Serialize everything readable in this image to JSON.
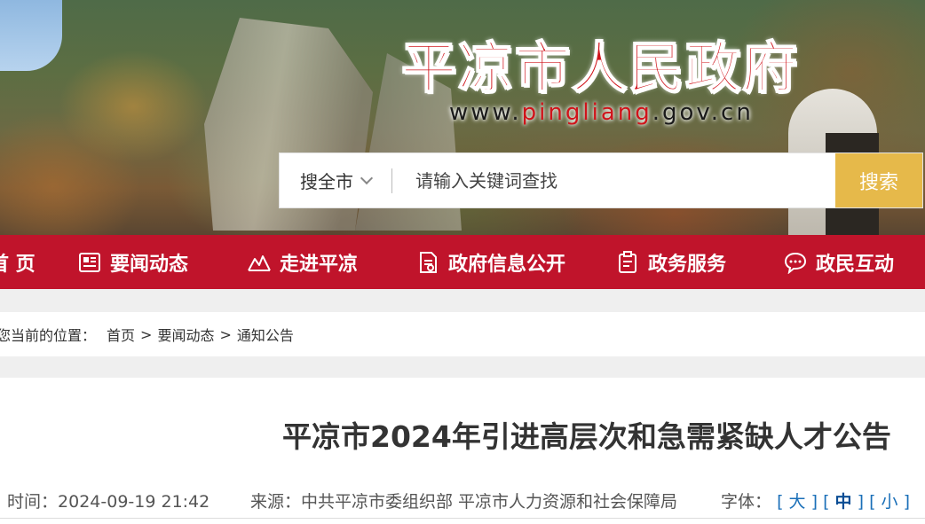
{
  "header": {
    "site_title": "平凉市人民政府",
    "url_prefix": "www.",
    "url_highlight": "pingliang",
    "url_suffix": ".gov.cn"
  },
  "search": {
    "scope_label": "搜全市",
    "placeholder": "请输入关键词查找",
    "button_label": "搜索"
  },
  "nav": {
    "items": [
      {
        "label": "首 页",
        "icon": "home-icon"
      },
      {
        "label": "要闻动态",
        "icon": "newspaper-icon"
      },
      {
        "label": "走进平凉",
        "icon": "mountain-icon"
      },
      {
        "label": "政府信息公开",
        "icon": "document-icon"
      },
      {
        "label": "政务服务",
        "icon": "clipboard-icon"
      },
      {
        "label": "政民互动",
        "icon": "chat-icon"
      }
    ]
  },
  "breadcrumb": {
    "prefix": "您当前的位置：",
    "items": [
      "首页",
      "要闻动态",
      "通知公告"
    ],
    "separator": ">"
  },
  "article": {
    "title": "平凉市2024年引进高层次和急需紧缺人才公告",
    "time_label": "时间：",
    "time_value": "2024-09-19 21:42",
    "source_label": "来源：",
    "source_value": "中共平凉市委组织部 平凉市人力资源和社会保障局",
    "font_label": "字体：",
    "font_large": "大",
    "font_medium": "中",
    "font_small": "小"
  },
  "colors": {
    "nav_red": "#c0142b",
    "title_red": "#d0131a",
    "search_button": "#e6b94a",
    "link_blue": "#1a6fb8"
  }
}
